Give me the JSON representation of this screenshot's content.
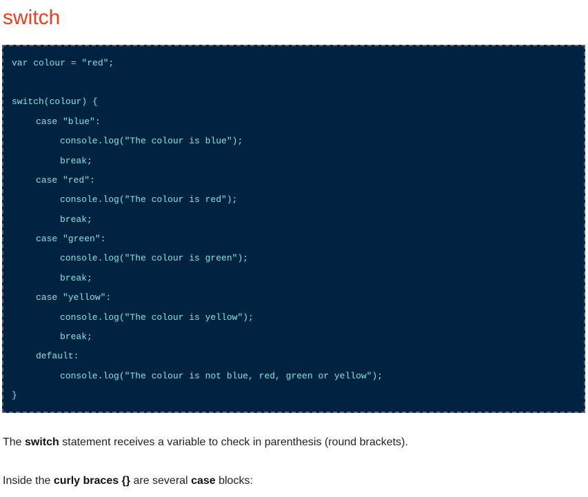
{
  "page": {
    "title": "switch"
  },
  "code": {
    "lines": [
      "var colour = \"red\";",
      "",
      "switch(colour) {",
      "case \"blue\":",
      "console.log(\"The colour is blue\");",
      "break;",
      "case \"red\":",
      "console.log(\"The colour is red\");",
      "break;",
      "case \"green\":",
      "console.log(\"The colour is green\");",
      "break;",
      "case \"yellow\":",
      "console.log(\"The colour is yellow\");",
      "break;",
      "default:",
      "console.log(\"The colour is not blue, red, green or yellow\");",
      "}"
    ]
  },
  "paragraphs": {
    "p1": {
      "t1": "The ",
      "b1": "switch",
      "t2": " statement receives a variable to check in parenthesis (round brackets)."
    },
    "p2": {
      "t1": "Inside the ",
      "b1": "curly braces {}",
      "t2": " are several ",
      "b2": "case",
      "t3": " blocks:"
    }
  },
  "colors": {
    "title": "#e8401c",
    "code_background": "#012241",
    "code_text": "#7fe7e1",
    "code_border": "#556577"
  }
}
